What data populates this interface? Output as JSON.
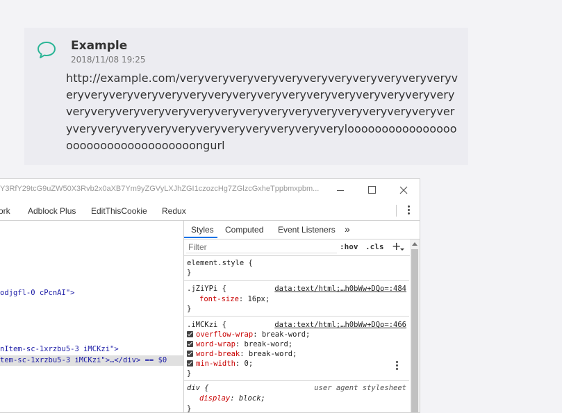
{
  "message": {
    "author": "Example",
    "timestamp": "2018/11/08 19:25",
    "text": "http://example.com/veryveryveryveryveryveryveryveryveryveryveryveryveryveryveryveryveryveryveryveryveryveryveryveryveryveryveryveryveryveryveryveryveryveryveryveryveryveryveryveryveryveryveryveryveryveryveryveryveryveryveryveryveryverylooooooooooooooooooooooooooooooooooongurl"
  },
  "devtools": {
    "window_title": "Y3RfY29tcG9uZW50X3Rvb2x0aXB7Ym9yZGVyLXJhZGI1czozcHg7ZGlzcGxheTppbmxpbm...",
    "tabs": [
      "ork",
      "Adblock Plus",
      "EditThisCookie",
      "Redux"
    ],
    "elements": [
      "odjgfl-0 cPcnAI\">",
      "nItem-sc-1xrzbu5-3 iMCKzi\">",
      "tem-sc-1xrzbu5-3 iMCKzi\">…</div> == $0"
    ],
    "sidebar_tabs": [
      "Styles",
      "Computed",
      "Event Listeners",
      "»"
    ],
    "filter_placeholder": "Filter",
    "hov": ":hov",
    "cls": ".cls",
    "plus": "+",
    "rules": {
      "element_style": "element.style {",
      "close": "}",
      "r1_selector": ".jZiYPi {",
      "r1_source": "data:text/html;…h0bWw+DQo=:484",
      "r1_p1": "font-size",
      "r1_v1": " 16px;",
      "r2_selector": ".iMCKzi {",
      "r2_source": "data:text/html;…h0bWw+DQo=:466",
      "r2_p1": "overflow-wrap",
      "r2_v1": " break-word;",
      "r2_p2": "word-wrap",
      "r2_v2": " break-word;",
      "r2_p3": "word-break",
      "r2_v3": " break-word;",
      "r2_p4": "min-width",
      "r2_v4": " 0;",
      "r3_selector": "div {",
      "r3_source": "user agent stylesheet",
      "r3_p1": "display",
      "r3_v1": " block;"
    }
  },
  "colors": {
    "accent_bubble": "#2bb596",
    "devtools_active_tab": "#1a73e8"
  }
}
